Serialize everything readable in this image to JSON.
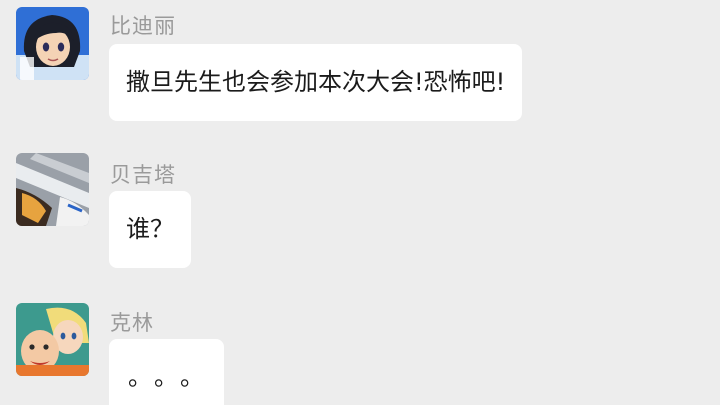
{
  "messages": [
    {
      "sender": "比迪丽",
      "text": "撒旦先生也会参加本次大会!恐怖吧!",
      "avatar_icon": "videl-avatar-icon"
    },
    {
      "sender": "贝吉塔",
      "text": "谁？",
      "avatar_icon": "vegeta-avatar-icon"
    },
    {
      "sender": "克林",
      "text": "。。。",
      "avatar_icon": "krillin-avatar-icon"
    }
  ],
  "colors": {
    "background": "#ededed",
    "bubble": "#ffffff",
    "sender_name": "#9a9a9a",
    "message_text": "#1b1b1b"
  }
}
